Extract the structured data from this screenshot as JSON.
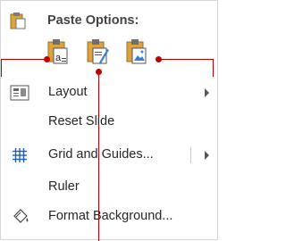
{
  "header": {
    "title": "Paste Options:"
  },
  "paste_options": [
    {
      "name": "keep-source-formatting-icon"
    },
    {
      "name": "use-destination-theme-icon"
    },
    {
      "name": "picture-icon"
    }
  ],
  "menu": {
    "layout": "Layout",
    "reset_slide": "Reset Slide",
    "grid_and_guides": "Grid and Guides...",
    "ruler": "Ruler",
    "format_background": "Format Background..."
  },
  "colors": {
    "callout": "#c00000",
    "accent": "#1f5fbf"
  }
}
